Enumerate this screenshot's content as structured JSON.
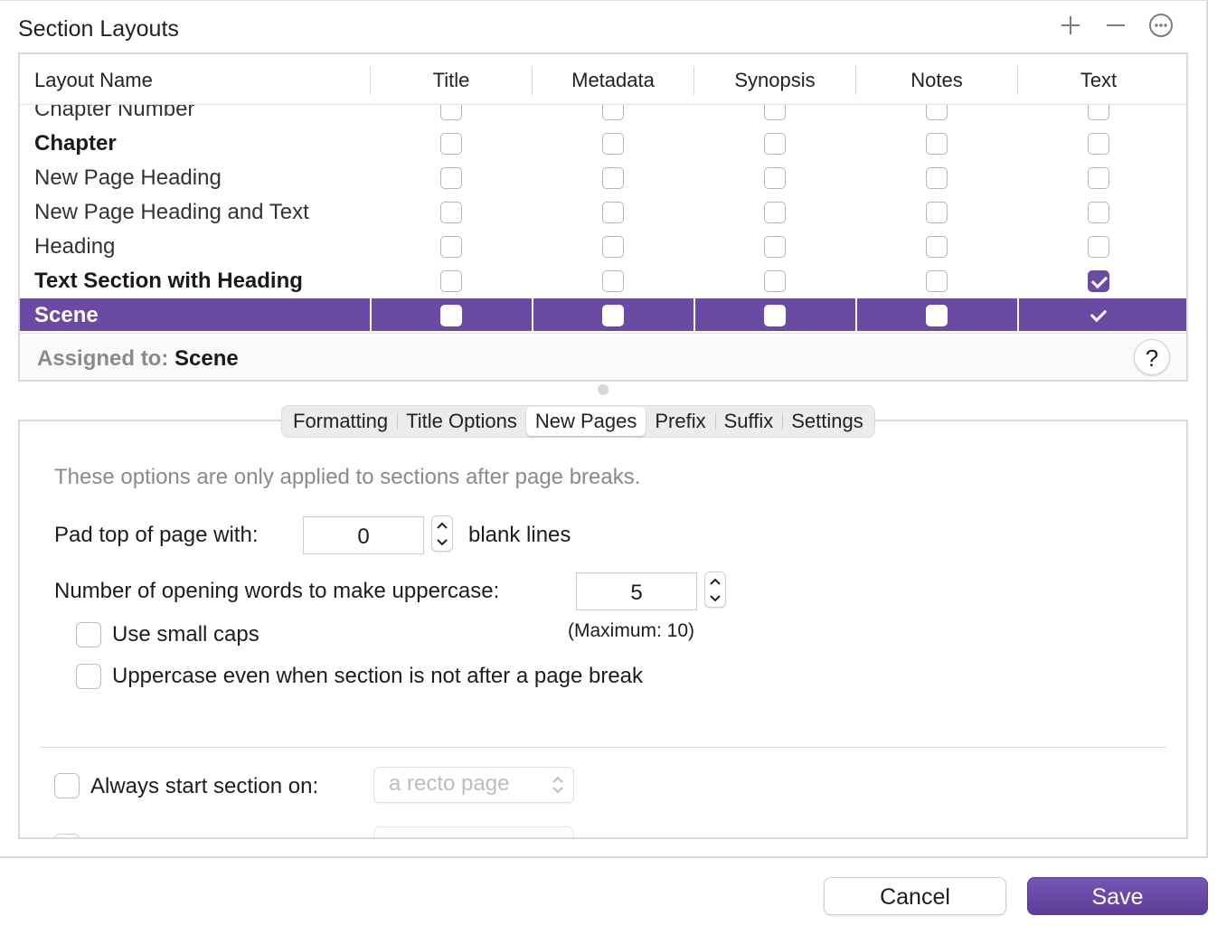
{
  "panel": {
    "title": "Section Layouts"
  },
  "icons": {
    "add": "plus-icon",
    "remove": "minus-icon",
    "more": "ellipsis-circle-icon"
  },
  "table": {
    "columns": [
      "Layout Name",
      "Title",
      "Metadata",
      "Synopsis",
      "Notes",
      "Text"
    ],
    "rows": [
      {
        "name": "Chapter Number",
        "bold": false,
        "selected": false,
        "checks": [
          false,
          false,
          false,
          false,
          false
        ]
      },
      {
        "name": "Chapter",
        "bold": true,
        "selected": false,
        "checks": [
          false,
          false,
          false,
          false,
          false
        ]
      },
      {
        "name": "New Page Heading",
        "bold": false,
        "selected": false,
        "checks": [
          false,
          false,
          false,
          false,
          false
        ]
      },
      {
        "name": "New Page Heading and Text",
        "bold": false,
        "selected": false,
        "checks": [
          false,
          false,
          false,
          false,
          false
        ]
      },
      {
        "name": "Heading",
        "bold": false,
        "selected": false,
        "checks": [
          false,
          false,
          false,
          false,
          false
        ]
      },
      {
        "name": "Text Section with Heading",
        "bold": true,
        "selected": false,
        "checks": [
          false,
          false,
          false,
          false,
          true
        ]
      },
      {
        "name": "Scene",
        "bold": true,
        "selected": true,
        "checks": [
          false,
          false,
          false,
          false,
          true
        ]
      }
    ]
  },
  "assigned": {
    "label": "Assigned to:",
    "value": "Scene",
    "help": "?"
  },
  "tabs": [
    {
      "label": "Formatting",
      "active": false
    },
    {
      "label": "Title Options",
      "active": false
    },
    {
      "label": "New Pages",
      "active": true
    },
    {
      "label": "Prefix",
      "active": false
    },
    {
      "label": "Suffix",
      "active": false
    },
    {
      "label": "Settings",
      "active": false
    }
  ],
  "new_pages": {
    "info": "These options are only applied to sections after page breaks.",
    "pad_label": "Pad top of page with:",
    "pad_value": "0",
    "pad_suffix": "blank lines",
    "uppercase_label": "Number of opening words to make uppercase:",
    "uppercase_value": "5",
    "uppercase_max": "(Maximum: 10)",
    "small_caps_label": "Use small caps",
    "small_caps_checked": false,
    "uppercase_always_label": "Uppercase even when section is not after a page break",
    "uppercase_always_checked": false,
    "always_start_label": "Always start section on:",
    "always_start_checked": false,
    "always_start_value": "a recto page"
  },
  "footer": {
    "cancel": "Cancel",
    "save": "Save"
  },
  "colors": {
    "accent": "#6a4aa2",
    "selected_row": "#6a4aa2"
  }
}
